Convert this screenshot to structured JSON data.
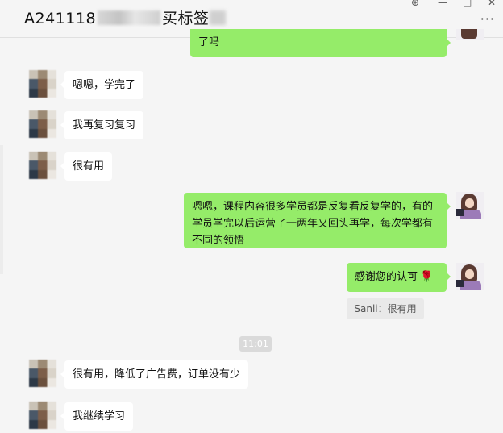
{
  "header": {
    "title_prefix": "A241118",
    "title_suffix": "买标签",
    "more": "···",
    "ctl_pin": "⊕",
    "ctl_min": "—",
    "ctl_max": "□",
    "ctl_close": "✕"
  },
  "messages": [
    {
      "side": "out",
      "text": "了吗"
    },
    {
      "side": "in",
      "text": "嗯嗯，学完了"
    },
    {
      "side": "in",
      "text": "我再复习复习"
    },
    {
      "side": "in",
      "text": "很有用"
    },
    {
      "side": "out",
      "text": "嗯嗯，课程内容很多学员都是反复看反复学的，有的学员学完以后运营了一两年又回头再学，每次学都有不同的领悟"
    },
    {
      "side": "out",
      "text": "感谢您的认可",
      "emoji": "🌹"
    },
    {
      "quote": "Sanli：很有用"
    },
    {
      "time": "11:01"
    },
    {
      "side": "in",
      "text": "很有用，降低了广告费，订单没有少"
    },
    {
      "side": "in",
      "text": "我继续学习"
    }
  ]
}
